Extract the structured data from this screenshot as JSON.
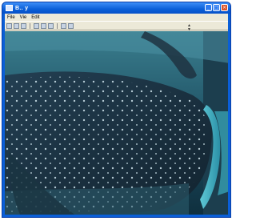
{
  "window": {
    "title": "B.. y",
    "controls": {
      "minimize": "_",
      "maximize": "□",
      "close": "×"
    }
  },
  "menu": {
    "items": [
      "File",
      "Vie",
      "Edit"
    ]
  },
  "toolbar": {
    "buttons": [
      "open",
      "save",
      "print",
      "zoom-in",
      "zoom-out",
      "fit",
      "prev",
      "next"
    ]
  },
  "image": {
    "description_icon": "whale-shark-photo"
  }
}
